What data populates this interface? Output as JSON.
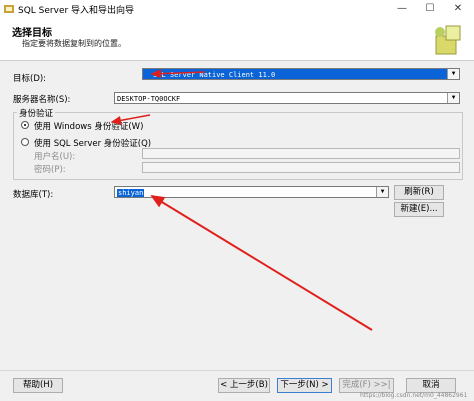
{
  "window": {
    "title": "SQL Server 导入和导出向导",
    "minimize": "—",
    "maximize": "☐",
    "close": "✕"
  },
  "header": {
    "title": "选择目标",
    "subtitle": "指定要将数据复制到的位置。"
  },
  "form": {
    "destination_label": "目标(D):",
    "destination_value": "SQL Server Native Client 11.0",
    "server_label": "服务器名称(S):",
    "server_value": "DESKTOP-TQ0OCKF",
    "auth_group_label": "身份验证",
    "auth_windows_label": "使用 Windows 身份验证(W)",
    "auth_sql_label": "使用 SQL Server 身份验证(Q)",
    "username_label": "用户名(U):",
    "password_label": "密码(P):",
    "database_label": "数据库(T):",
    "database_value": "shiyan",
    "refresh_button": "刷新(R)",
    "new_button": "新建(E)..."
  },
  "footer": {
    "help_button": "帮助(H)",
    "back_button": "< 上一步(B)",
    "next_button": "下一步(N) >",
    "finish_button": "完成(F) >>|",
    "cancel_button": "取消"
  },
  "watermark": "https://blog.csdn.net/m0_44862961",
  "colors": {
    "selection": "#0a64d8",
    "arrow": "#e0201c"
  }
}
